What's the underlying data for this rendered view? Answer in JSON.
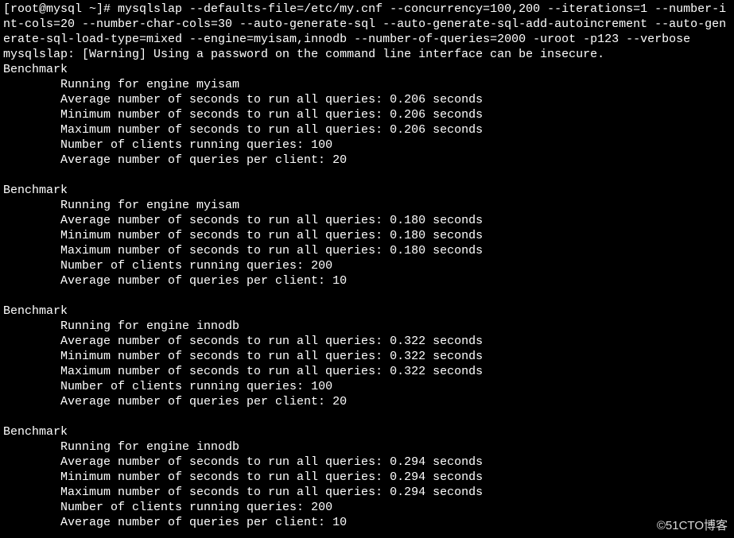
{
  "prompt": "[root@mysql ~]# ",
  "command": "mysqlslap --defaults-file=/etc/my.cnf --concurrency=100,200 --iterations=1 --number-int-cols=20 --number-char-cols=30 --auto-generate-sql --auto-generate-sql-add-autoincrement --auto-generate-sql-load-type=mixed --engine=myisam,innodb --number-of-queries=2000 -uroot -p123 --verbose",
  "warning": "mysqlslap: [Warning] Using a password on the command line interface can be insecure.",
  "label_benchmark": "Benchmark",
  "label_running": "Running for engine ",
  "label_avg": "Average number of seconds to run all queries: ",
  "label_min": "Minimum number of seconds to run all queries: ",
  "label_max": "Maximum number of seconds to run all queries: ",
  "label_clients": "Number of clients running queries: ",
  "label_qpc": "Average number of queries per client: ",
  "seconds_suffix": " seconds",
  "benchmarks": [
    {
      "engine": "myisam",
      "avg": "0.206",
      "min": "0.206",
      "max": "0.206",
      "clients": "100",
      "qpc": "20"
    },
    {
      "engine": "myisam",
      "avg": "0.180",
      "min": "0.180",
      "max": "0.180",
      "clients": "200",
      "qpc": "10"
    },
    {
      "engine": "innodb",
      "avg": "0.322",
      "min": "0.322",
      "max": "0.322",
      "clients": "100",
      "qpc": "20"
    },
    {
      "engine": "innodb",
      "avg": "0.294",
      "min": "0.294",
      "max": "0.294",
      "clients": "200",
      "qpc": "10"
    }
  ],
  "watermark": "©51CTO博客"
}
